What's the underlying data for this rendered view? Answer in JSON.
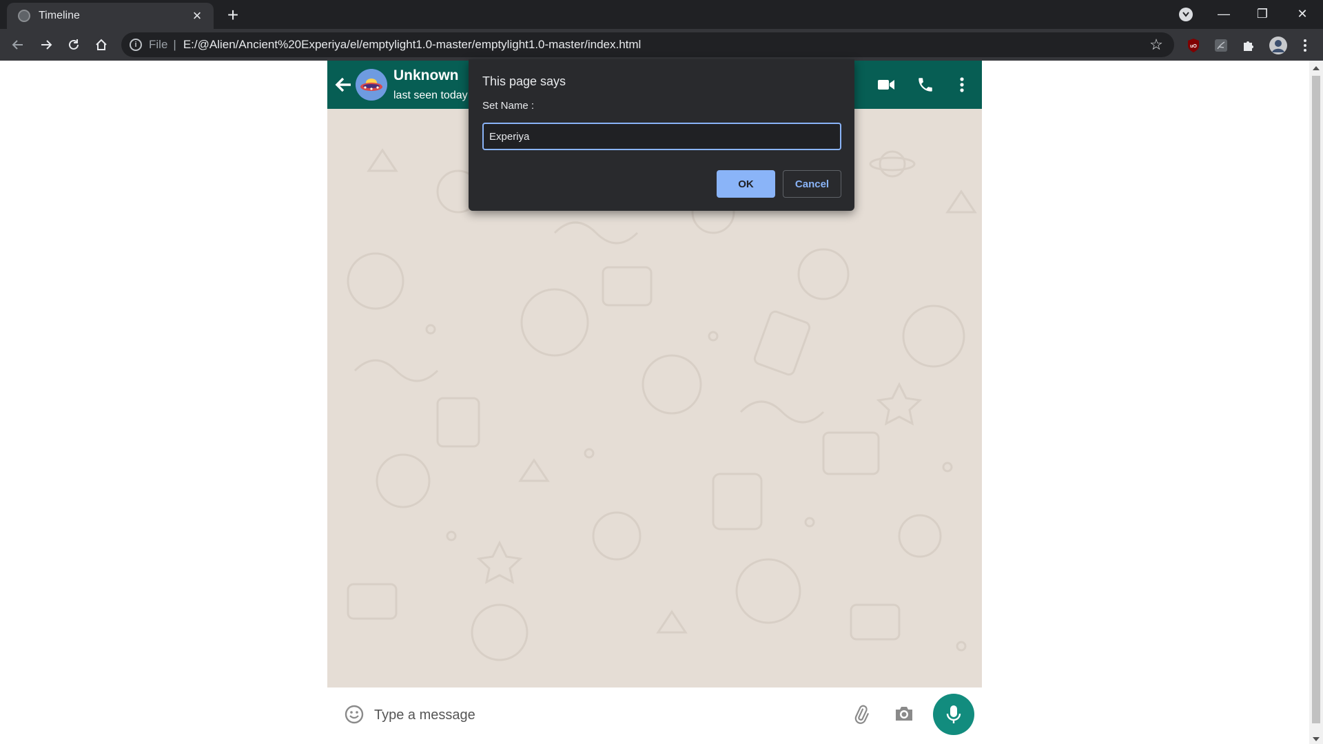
{
  "browser": {
    "tab_title": "Timeline",
    "new_tab": "+",
    "close_tab": "×",
    "omnibox": {
      "scheme": "File",
      "separator": "|",
      "url": "E:/@Alien/Ancient%20Experiya/el/emptylight1.0-master/emptylight1.0-master/index.html"
    },
    "window_controls": {
      "minimize": "—",
      "restore": "❐",
      "close": "✕"
    },
    "extensions": {
      "ublock_label": "uO"
    }
  },
  "chat": {
    "contact_name": "Unknown",
    "contact_status": "last seen today",
    "message_placeholder": "Type a message",
    "header_bg": "#075e54",
    "wallpaper_bg": "#e5ddd5",
    "mic_bg": "#128c7e"
  },
  "dialog": {
    "title": "This page says",
    "message": "Set Name :",
    "input_value": "Experiya",
    "ok_label": "OK",
    "cancel_label": "Cancel",
    "accent": "#8ab4f8"
  }
}
